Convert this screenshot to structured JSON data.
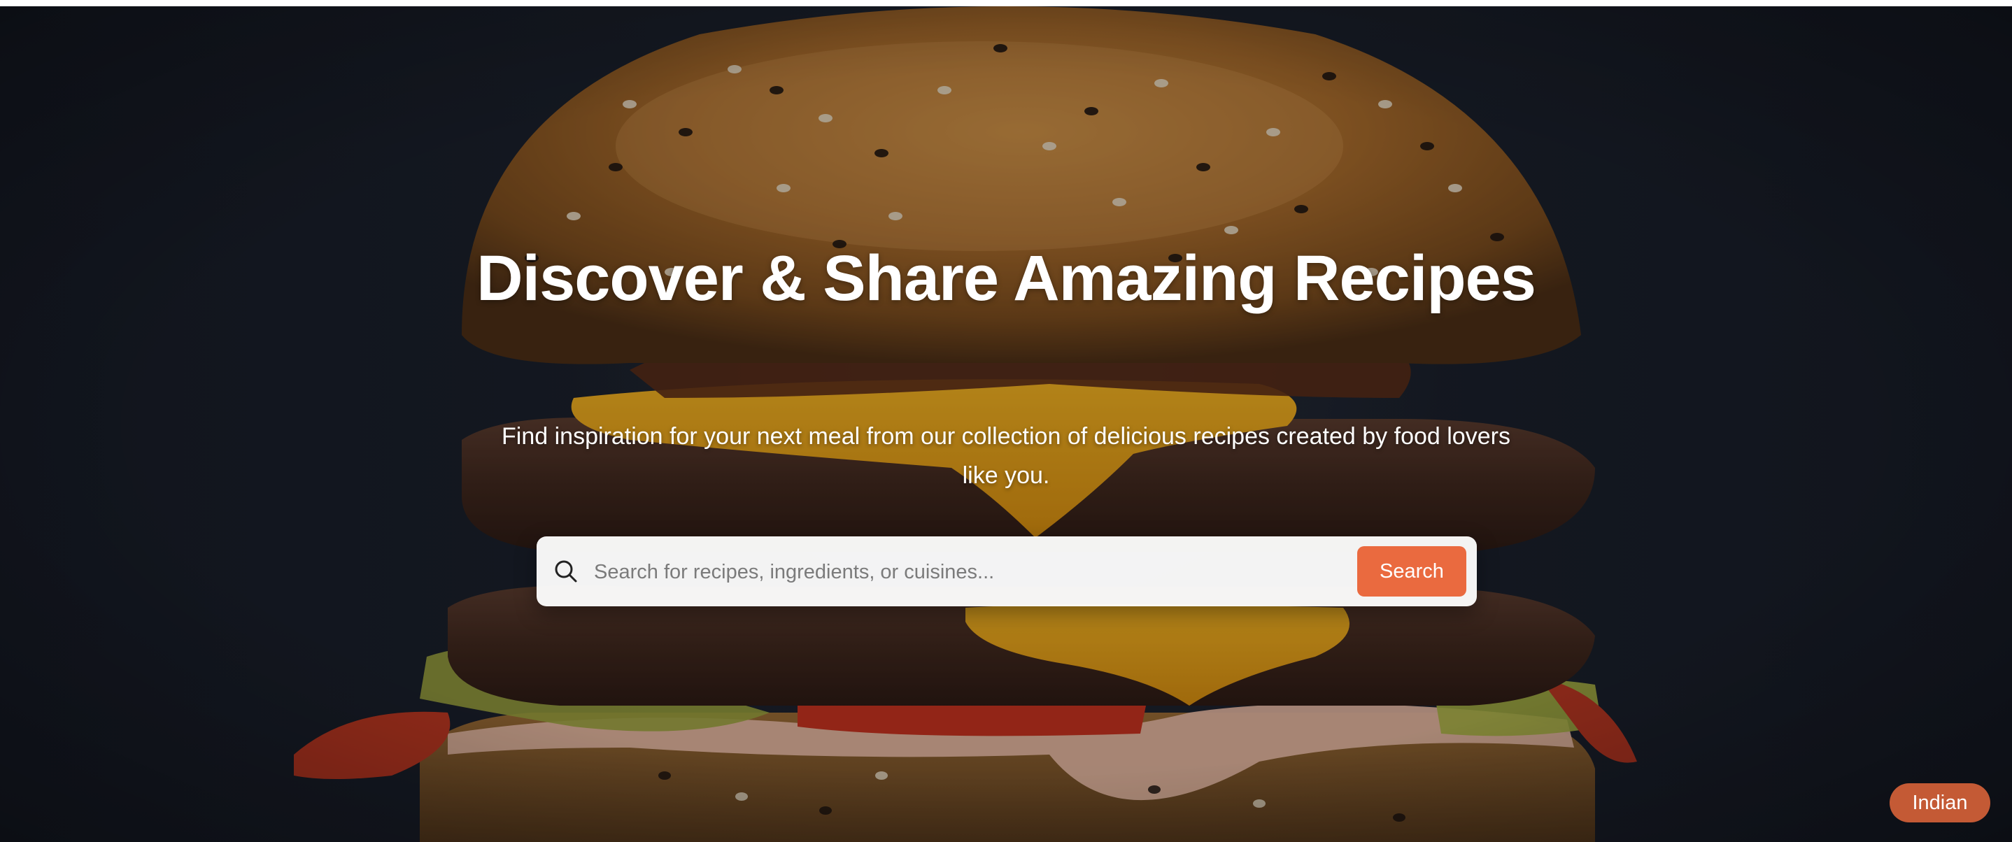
{
  "hero": {
    "title": "Discover & Share Amazing Recipes",
    "subtitle": "Find inspiration for your next meal from our collection of delicious recipes created by food lovers like you.",
    "background_icon": "burger-photo"
  },
  "search": {
    "placeholder": "Search for recipes, ingredients, or cuisines...",
    "value": "",
    "button_label": "Search",
    "icon": "search-icon"
  },
  "tags": {
    "visible_tag": "Indian"
  },
  "colors": {
    "accent": "#ea6a3f",
    "tag": "#c45a35",
    "backdrop": "#161b24"
  }
}
